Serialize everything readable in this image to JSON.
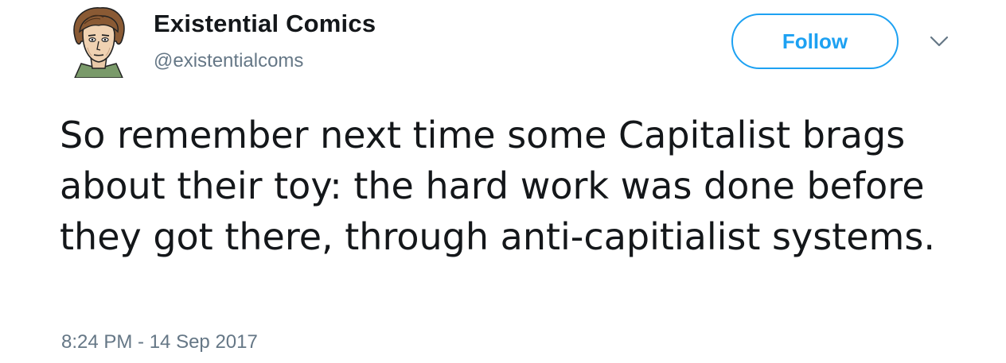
{
  "author": {
    "display_name": "Existential Comics",
    "handle": "@existentialcoms"
  },
  "actions": {
    "follow_label": "Follow",
    "more_icon": "chevron-down-icon"
  },
  "tweet": {
    "text": "So remember next time some Capitalist brags about their toy: the hard work was done before they got there, through anti-capitialist systems.",
    "timestamp": "8:24 PM - 14 Sep 2017"
  },
  "colors": {
    "accent": "#1da1f2",
    "text": "#14171a",
    "secondary_text": "#657786"
  }
}
